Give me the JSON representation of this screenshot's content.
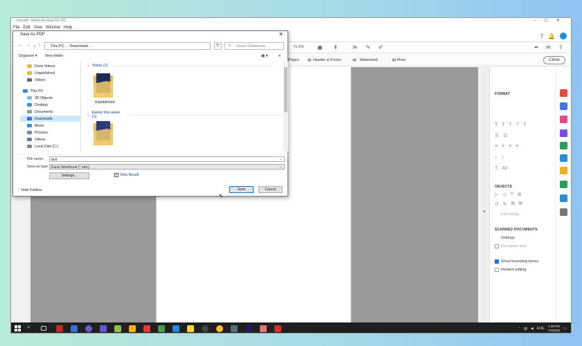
{
  "acrobat": {
    "title": "test.pdf - Adobe Acrobat Pro DC",
    "menu": [
      "File",
      "Edit",
      "View",
      "Window",
      "Help"
    ],
    "zoom": "71.5%",
    "sub_items": [
      "Pages",
      "Header & Footer",
      "Watermark",
      "More"
    ],
    "close_label": "Close"
  },
  "right_panel": {
    "format_heading": "FORMAT",
    "objects_heading": "OBJECTS",
    "edit_using": "Edit Using...",
    "scanned_heading": "SCANNED DOCUMENTS",
    "settings": "Settings",
    "recognize_text": "Recognize text",
    "show_bounding": "Show bounding boxes",
    "restrict_editing": "Restrict editing"
  },
  "dialog": {
    "title": "Save As PDF",
    "breadcrumb": [
      "This PC",
      "Downloads"
    ],
    "search_placeholder": "Search Downloads",
    "organize": "Organize",
    "new_folder": "New folder",
    "nav_items": [
      {
        "label": "Done Videos",
        "icon": "folder-icon"
      },
      {
        "label": "Unpublished",
        "icon": "folder-icon"
      },
      {
        "label": "Videos",
        "icon": "folder-icon"
      },
      {
        "label": "This PC",
        "icon": "pc-icon"
      },
      {
        "label": "3D Objects",
        "icon": "folder-icon"
      },
      {
        "label": "Desktop",
        "icon": "desktop-icon"
      },
      {
        "label": "Documents",
        "icon": "documents-icon"
      },
      {
        "label": "Downloads",
        "icon": "download-icon"
      },
      {
        "label": "Music",
        "icon": "music-icon"
      },
      {
        "label": "Pictures",
        "icon": "pictures-icon"
      },
      {
        "label": "Videos",
        "icon": "video-icon"
      },
      {
        "label": "Local Disk (C:)",
        "icon": "disk-icon"
      }
    ],
    "groups": [
      {
        "label": "Today (1)",
        "files": [
          "Unpublished"
        ]
      },
      {
        "label": "Earlier this week (1)",
        "files": [
          ""
        ]
      }
    ],
    "file_name_label": "File name:",
    "file_name_value": "test",
    "save_type_label": "Save as type:",
    "save_type_value": "Excel Workbook (*.xlsx)",
    "settings_btn": "Settings...",
    "view_result": "View Result",
    "save_btn": "Save",
    "cancel_btn": "Cancel",
    "hide_folders": "Hide Folders"
  },
  "taskbar": {
    "time": "1:38 PM",
    "date": "7/4/2020",
    "lang": "ENG"
  }
}
